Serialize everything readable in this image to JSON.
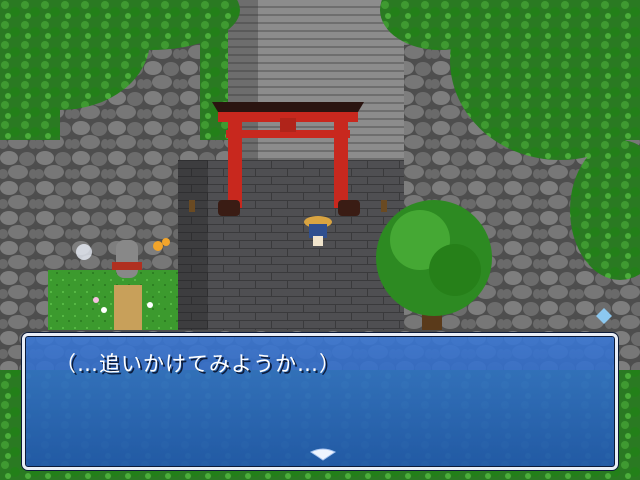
{
  "dialog": {
    "text": "（…追いかけてみようか…）",
    "continue_icon": "pause-arrow-icon"
  },
  "colors": {
    "dialog_bg": "#2f6fd0",
    "dialog_border": "#e9eef6",
    "torii": "#c8281e",
    "foliage": "#2f8a2a",
    "stone": "#6b6b6b"
  }
}
